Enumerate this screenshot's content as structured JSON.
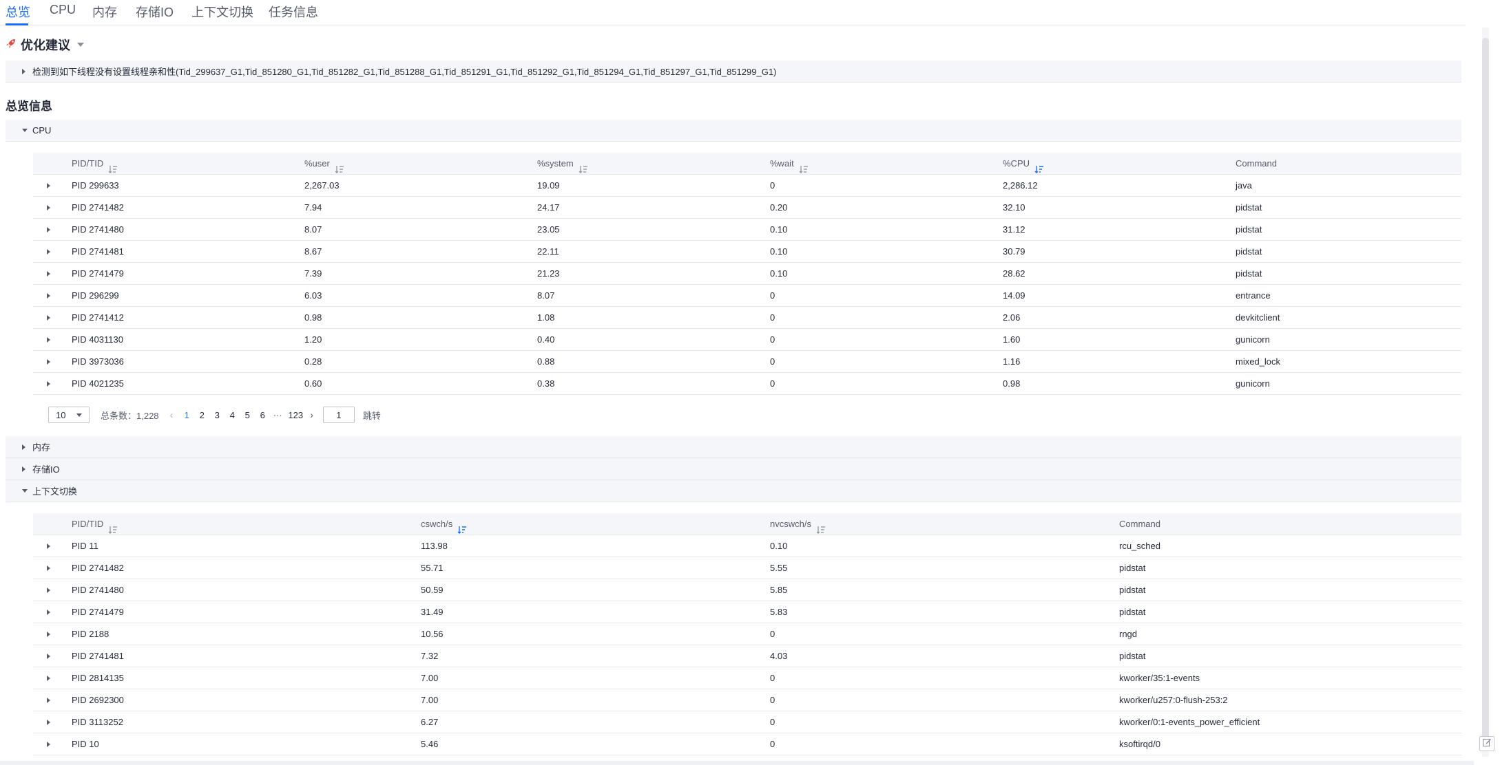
{
  "tabs": [
    "总览",
    "CPU",
    "内存",
    "存储IO",
    "上下文切换",
    "任务信息"
  ],
  "optimization": {
    "title": "优化建议",
    "suggestion": "检测到如下线程没有设置线程亲和性(Tid_299637_G1,Tid_851280_G1,Tid_851282_G1,Tid_851288_G1,Tid_851291_G1,Tid_851292_G1,Tid_851294_G1,Tid_851297_G1,Tid_851299_G1)"
  },
  "overview": {
    "title": "总览信息",
    "sections": [
      "CPU",
      "内存",
      "存储IO",
      "上下文切换"
    ]
  },
  "cpu_table": {
    "headers": [
      "PID/TID",
      "%user",
      "%system",
      "%wait",
      "%CPU",
      "Command"
    ],
    "rows": [
      [
        "PID 299633",
        "2,267.03",
        "19.09",
        "0",
        "2,286.12",
        "java"
      ],
      [
        "PID 2741482",
        "7.94",
        "24.17",
        "0.20",
        "32.10",
        "pidstat"
      ],
      [
        "PID 2741480",
        "8.07",
        "23.05",
        "0.10",
        "31.12",
        "pidstat"
      ],
      [
        "PID 2741481",
        "8.67",
        "22.11",
        "0.10",
        "30.79",
        "pidstat"
      ],
      [
        "PID 2741479",
        "7.39",
        "21.23",
        "0.10",
        "28.62",
        "pidstat"
      ],
      [
        "PID 296299",
        "6.03",
        "8.07",
        "0",
        "14.09",
        "entrance"
      ],
      [
        "PID 2741412",
        "0.98",
        "1.08",
        "0",
        "2.06",
        "devkitclient"
      ],
      [
        "PID 4031130",
        "1.20",
        "0.40",
        "0",
        "1.60",
        "gunicorn"
      ],
      [
        "PID 3973036",
        "0.28",
        "0.88",
        "0",
        "1.16",
        "mixed_lock"
      ],
      [
        "PID 4021235",
        "0.60",
        "0.38",
        "0",
        "0.98",
        "gunicorn"
      ]
    ]
  },
  "pagination": {
    "page_size": "10",
    "total_label": "总条数：1,228",
    "pages": [
      "1",
      "2",
      "3",
      "4",
      "5",
      "6"
    ],
    "ellipsis": "···",
    "last_page": "123",
    "jump_value": "1",
    "jump_label": "跳转",
    "prev": "‹",
    "next": "›"
  },
  "ctx_table": {
    "headers": [
      "PID/TID",
      "cswch/s",
      "nvcswch/s",
      "Command"
    ],
    "rows": [
      [
        "PID 11",
        "113.98",
        "0.10",
        "rcu_sched"
      ],
      [
        "PID 2741482",
        "55.71",
        "5.55",
        "pidstat"
      ],
      [
        "PID 2741480",
        "50.59",
        "5.85",
        "pidstat"
      ],
      [
        "PID 2741479",
        "31.49",
        "5.83",
        "pidstat"
      ],
      [
        "PID 2188",
        "10.56",
        "0",
        "rngd"
      ],
      [
        "PID 2741481",
        "7.32",
        "4.03",
        "pidstat"
      ],
      [
        "PID 2814135",
        "7.00",
        "0",
        "kworker/35:1-events"
      ],
      [
        "PID 2692300",
        "7.00",
        "0",
        "kworker/u257:0-flush-253:2"
      ],
      [
        "PID 3113252",
        "6.27",
        "0",
        "kworker/0:1-events_power_efficient"
      ],
      [
        "PID 10",
        "5.46",
        "0",
        "ksoftirqd/0"
      ]
    ]
  },
  "colors": {
    "accent": "#1a6cff",
    "text": "#252b3a",
    "muted": "#575d6c",
    "strip_bg": "#f5f6f9",
    "border": "#e6e8ed"
  }
}
